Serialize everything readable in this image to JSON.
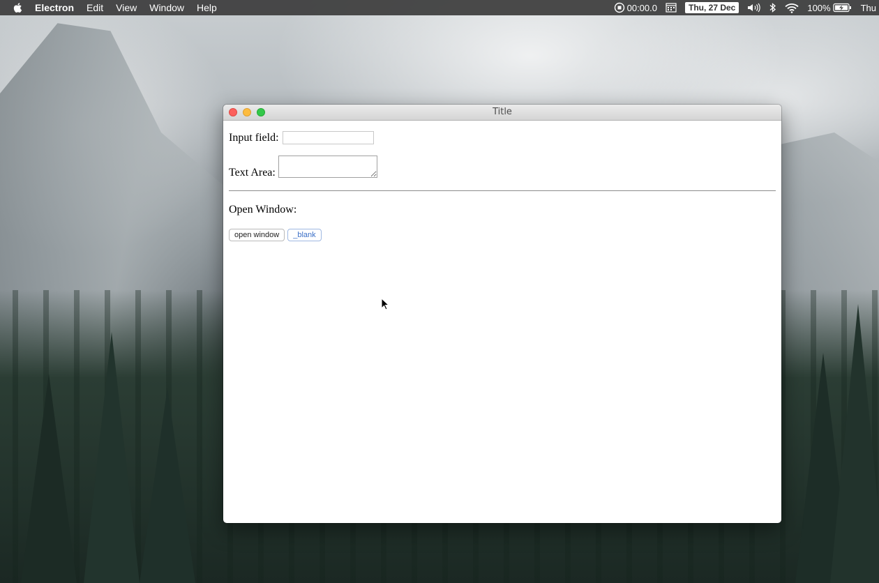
{
  "menubar": {
    "app_name": "Electron",
    "items": [
      "Edit",
      "View",
      "Window",
      "Help"
    ],
    "status": {
      "recording_time": "00:00.0",
      "date": "Thu, 27 Dec",
      "battery": "100%",
      "clock": "Thu"
    }
  },
  "window": {
    "title": "Title",
    "input_label": "Input field:",
    "input_value": "",
    "textarea_label": "Text Area:",
    "textarea_value": "",
    "open_window_label": "Open Window:",
    "buttons": {
      "open_window": "open window",
      "blank": "_blank"
    }
  },
  "colors": {
    "close": "#fc605c",
    "minimize": "#fdbc40",
    "maximize": "#34c84a",
    "link": "#3a6ec6"
  }
}
